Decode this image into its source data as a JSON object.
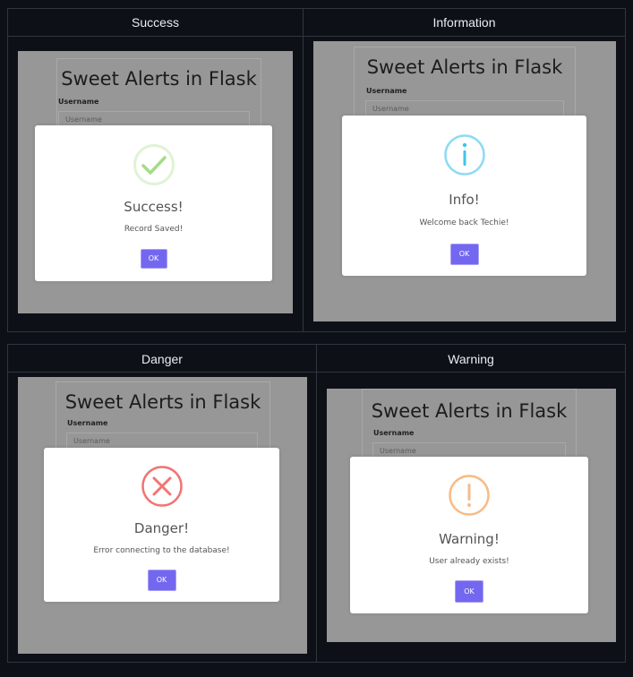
{
  "panels": {
    "success": {
      "heading": "Success",
      "form": {
        "title": "Sweet Alerts in Flask",
        "label": "Username",
        "placeholder": "Username"
      },
      "alert": {
        "title": "Success!",
        "text": "Record Saved!",
        "button": "OK",
        "icon": "check-icon",
        "color": "#a5dc86"
      }
    },
    "info": {
      "heading": "Information",
      "form": {
        "title": "Sweet Alerts in Flask",
        "label": "Username",
        "placeholder": "Username"
      },
      "alert": {
        "title": "Info!",
        "text": "Welcome back Techie!",
        "button": "OK",
        "icon": "info-icon",
        "color": "#3fc3ee"
      }
    },
    "danger": {
      "heading": "Danger",
      "form": {
        "title": "Sweet Alerts in Flask",
        "label": "Username",
        "placeholder": "Username"
      },
      "alert": {
        "title": "Danger!",
        "text": "Error connecting to the database!",
        "button": "OK",
        "icon": "close-icon",
        "color": "#f27474"
      }
    },
    "warning": {
      "heading": "Warning",
      "form": {
        "title": "Sweet Alerts in Flask",
        "label": "Username",
        "placeholder": "Username"
      },
      "alert": {
        "title": "Warning!",
        "text": "User already exists!",
        "button": "OK",
        "icon": "exclamation-icon",
        "color": "#f8bb86"
      }
    }
  },
  "colors": {
    "button": "#7367f0",
    "page_bg": "#0d1117",
    "border": "#30363d"
  }
}
